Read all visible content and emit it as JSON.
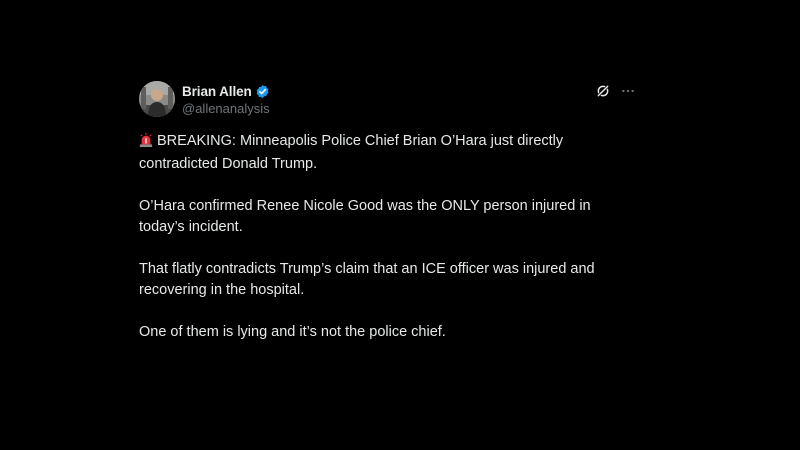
{
  "author": {
    "display_name": "Brian Allen",
    "handle": "@allenanalysis",
    "verified": true,
    "avatar_icon": "profile-photo"
  },
  "actions": {
    "grok_icon": "grok-icon",
    "more_icon": "more-icon"
  },
  "post": {
    "paragraphs": [
      "BREAKING: Minneapolis Police Chief Brian O’Hara just directly contradicted Donald Trump.",
      "O’Hara confirmed Renee Nicole Good was the ONLY person injured in today’s incident.",
      "That flatly contradicts Trump’s claim that an ICE officer was injured and recovering in the hospital.",
      "One of them is lying and it’s not the police chief."
    ],
    "lead_emoji": "siren-emoji"
  },
  "colors": {
    "background": "#000000",
    "text": "#e7e9ea",
    "secondary_text": "#71767b",
    "verified_blue": "#1d9bf0",
    "siren_red": "#e5323d"
  }
}
